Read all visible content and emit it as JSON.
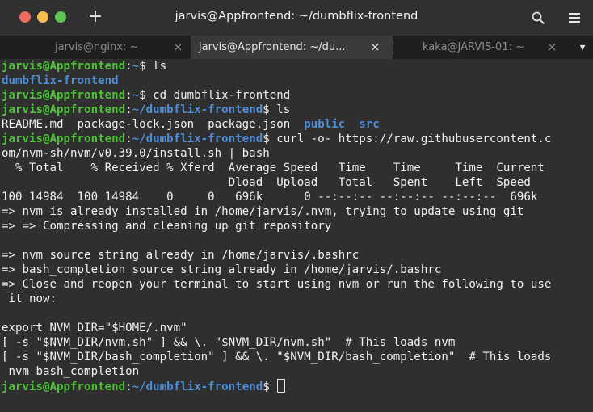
{
  "window": {
    "title": "jarvis@Appfrontend: ~/dumbflix-frontend",
    "new_tab_glyph": "+",
    "search_icon": "search-icon",
    "menu_icon": "hamburger-menu-icon",
    "colors": {
      "close": "#ed6a5e",
      "minimize": "#f6be4f",
      "maximize": "#61c554"
    }
  },
  "tabs": [
    {
      "label": "jarvis@nginx: ~",
      "close": "×",
      "active": false
    },
    {
      "label": "jarvis@Appfrontend: ~/du...",
      "close": "×",
      "active": true
    },
    {
      "label": "kaka@JARVIS-01: ~",
      "close": "×",
      "active": false
    }
  ],
  "tab_menu_glyph": "▼",
  "colors": {
    "prompt_user": "#50c23a",
    "prompt_path": "#4f8ed8",
    "text": "#f2f2f2",
    "background": "#2f2f2f"
  },
  "terminal": {
    "lines": [
      [
        {
          "t": "jarvis@Appfrontend",
          "c": "g"
        },
        {
          "t": ":"
        },
        {
          "t": "~",
          "c": "b"
        },
        {
          "t": "$ ls"
        }
      ],
      [
        {
          "t": "dumbflix-frontend",
          "c": "b"
        }
      ],
      [
        {
          "t": "jarvis@Appfrontend",
          "c": "g"
        },
        {
          "t": ":"
        },
        {
          "t": "~",
          "c": "b"
        },
        {
          "t": "$ cd dumbflix-frontend"
        }
      ],
      [
        {
          "t": "jarvis@Appfrontend",
          "c": "g"
        },
        {
          "t": ":"
        },
        {
          "t": "~/dumbflix-frontend",
          "c": "b"
        },
        {
          "t": "$ ls"
        }
      ],
      [
        {
          "t": "README.md  package-lock.json  package.json  "
        },
        {
          "t": "public",
          "c": "b"
        },
        {
          "t": "  "
        },
        {
          "t": "src",
          "c": "b"
        }
      ],
      [
        {
          "t": "jarvis@Appfrontend",
          "c": "g"
        },
        {
          "t": ":"
        },
        {
          "t": "~/dumbflix-frontend",
          "c": "b"
        },
        {
          "t": "$ curl -o- https://raw.githubusercontent.c"
        }
      ],
      [
        {
          "t": "om/nvm-sh/nvm/v0.39.0/install.sh | bash"
        }
      ],
      [
        {
          "t": "  % Total    % Received % Xferd  Average Speed   Time    Time     Time  Current"
        }
      ],
      [
        {
          "t": "                                 Dload  Upload   Total   Spent    Left  Speed"
        }
      ],
      [
        {
          "t": "100 14984  100 14984    0     0   696k      0 --:--:-- --:--:-- --:--:--  696k"
        }
      ],
      [
        {
          "t": "=> nvm is already installed in /home/jarvis/.nvm, trying to update using git"
        }
      ],
      [
        {
          "t": "=> => Compressing and cleaning up git repository"
        }
      ],
      [
        {
          "t": ""
        }
      ],
      [
        {
          "t": "=> nvm source string already in /home/jarvis/.bashrc"
        }
      ],
      [
        {
          "t": "=> bash_completion source string already in /home/jarvis/.bashrc"
        }
      ],
      [
        {
          "t": "=> Close and reopen your terminal to start using nvm or run the following to use"
        }
      ],
      [
        {
          "t": " it now:"
        }
      ],
      [
        {
          "t": ""
        }
      ],
      [
        {
          "t": "export NVM_DIR=\"$HOME/.nvm\""
        }
      ],
      [
        {
          "t": "[ -s \"$NVM_DIR/nvm.sh\" ] && \\. \"$NVM_DIR/nvm.sh\"  # This loads nvm"
        }
      ],
      [
        {
          "t": "[ -s \"$NVM_DIR/bash_completion\" ] && \\. \"$NVM_DIR/bash_completion\"  # This loads"
        }
      ],
      [
        {
          "t": " nvm bash_completion"
        }
      ],
      [
        {
          "t": "jarvis@Appfrontend",
          "c": "g"
        },
        {
          "t": ":"
        },
        {
          "t": "~/dumbflix-frontend",
          "c": "b"
        },
        {
          "t": "$ "
        },
        {
          "cursor": true
        }
      ]
    ]
  }
}
